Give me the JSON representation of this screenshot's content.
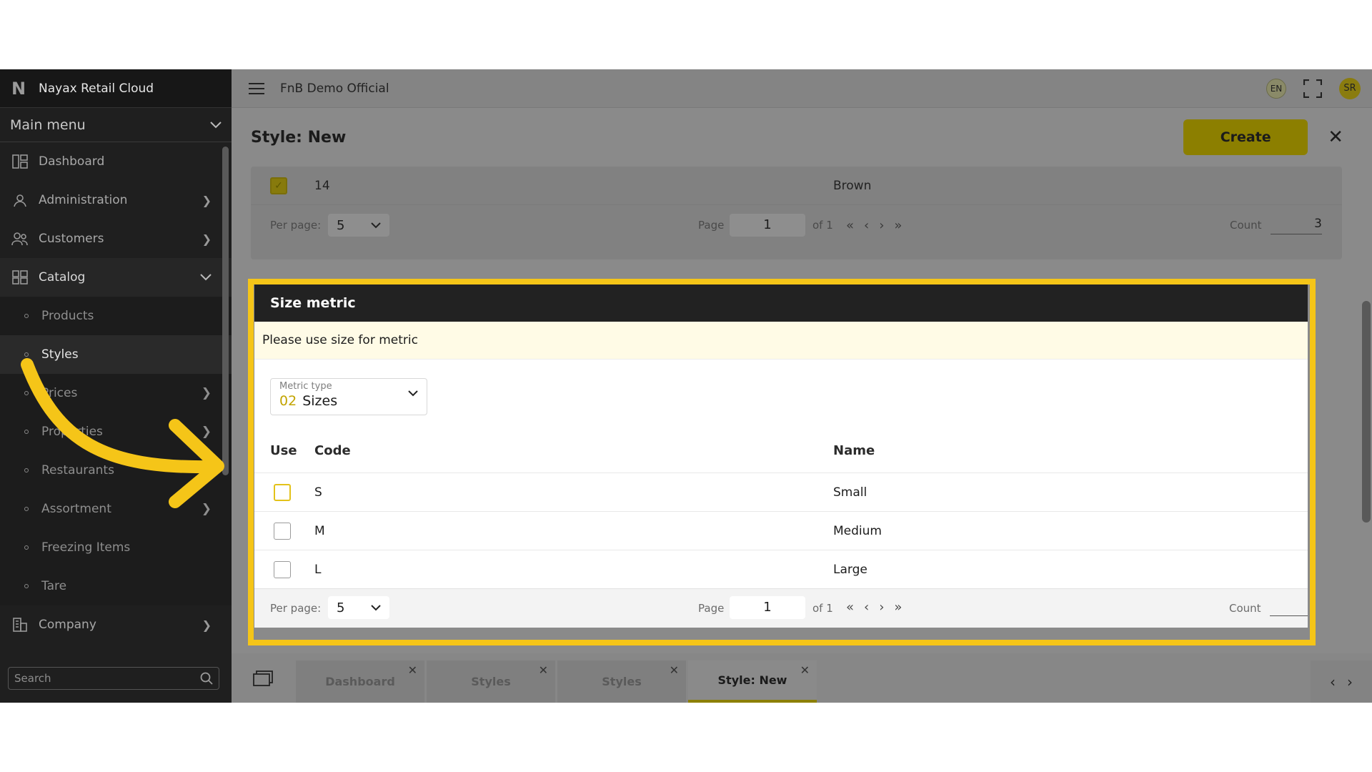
{
  "app": {
    "logo": "N",
    "name": "Nayax Retail Cloud",
    "main_menu": "Main menu"
  },
  "topbar": {
    "title": "FnB Demo Official",
    "lang": "EN",
    "avatar": "SR"
  },
  "sidebar": {
    "items": [
      {
        "label": "Dashboard",
        "icon": "dashboard-icon"
      },
      {
        "label": "Administration",
        "icon": "administration-icon"
      },
      {
        "label": "Customers",
        "icon": "customers-icon"
      },
      {
        "label": "Catalog",
        "icon": "catalog-icon"
      }
    ],
    "catalog_sub": [
      {
        "label": "Products"
      },
      {
        "label": "Styles"
      },
      {
        "label": "Prices"
      },
      {
        "label": "Properties"
      },
      {
        "label": "Restaurants"
      },
      {
        "label": "Assortment"
      },
      {
        "label": "Freezing Items"
      },
      {
        "label": "Tare"
      }
    ],
    "company": {
      "label": "Company",
      "icon": "company-icon"
    },
    "search_placeholder": "Search"
  },
  "page": {
    "title": "Style: New",
    "create_label": "Create"
  },
  "upper_table": {
    "row": {
      "code": "14",
      "name": "Brown",
      "checked": true
    },
    "pager": {
      "per_page_label": "Per page:",
      "per_page": "5",
      "page_label": "Page",
      "page": "1",
      "of": "of 1",
      "count_label": "Count",
      "count": "3"
    }
  },
  "size_metric": {
    "title": "Size metric",
    "notice": "Please use size for metric",
    "metric_type": {
      "caption": "Metric type",
      "code": "02",
      "label": "Sizes"
    },
    "columns": {
      "use": "Use",
      "code": "Code",
      "name": "Name"
    },
    "rows": [
      {
        "code": "S",
        "name": "Small"
      },
      {
        "code": "M",
        "name": "Medium"
      },
      {
        "code": "L",
        "name": "Large"
      }
    ],
    "pager": {
      "per_page_label": "Per page:",
      "per_page": "5",
      "page_label": "Page",
      "page": "1",
      "of": "of 1",
      "count_label": "Count"
    }
  },
  "tabs": [
    {
      "label": "Dashboard"
    },
    {
      "label": "Styles"
    },
    {
      "label": "Styles"
    },
    {
      "label": "Style: New"
    }
  ],
  "colors": {
    "highlight": "#f5c518",
    "accent": "#8c7f00",
    "arrow": "#f5c518"
  }
}
